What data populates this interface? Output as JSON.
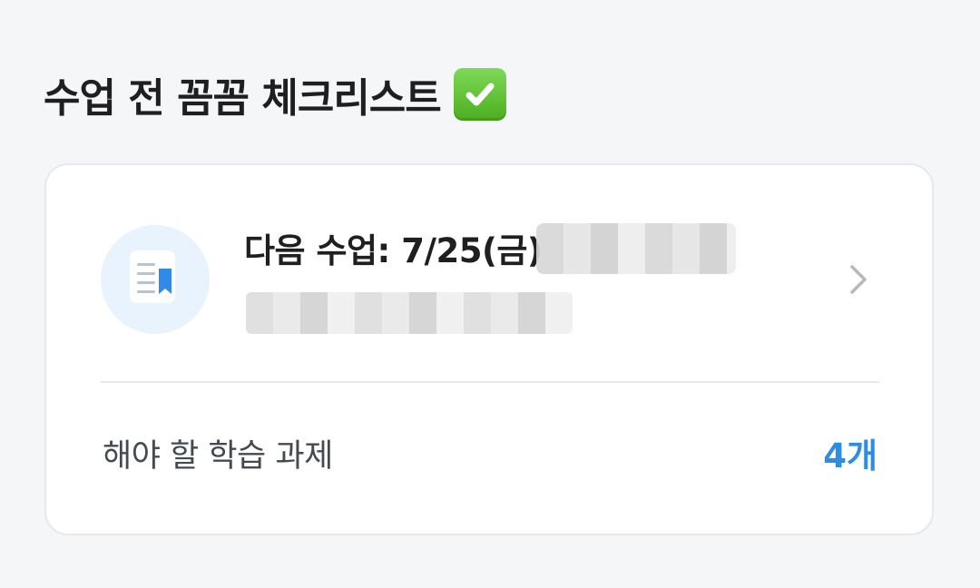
{
  "header": {
    "title": "수업 전 꼼꼼 체크리스트",
    "title_icon": "check-mark-button-emoji"
  },
  "next_lesson": {
    "icon": "lesson-book-icon",
    "title": "다음 수업: 7/25(금)",
    "chevron_icon": "chevron-right-icon"
  },
  "tasks": {
    "label": "해야 할 학습 과제",
    "count": "4개"
  },
  "colors": {
    "background": "#f5f6f8",
    "card": "#ffffff",
    "accent": "#2d8de3",
    "icon_circle": "#e8f3fd",
    "check_green": "#5cc52e"
  }
}
